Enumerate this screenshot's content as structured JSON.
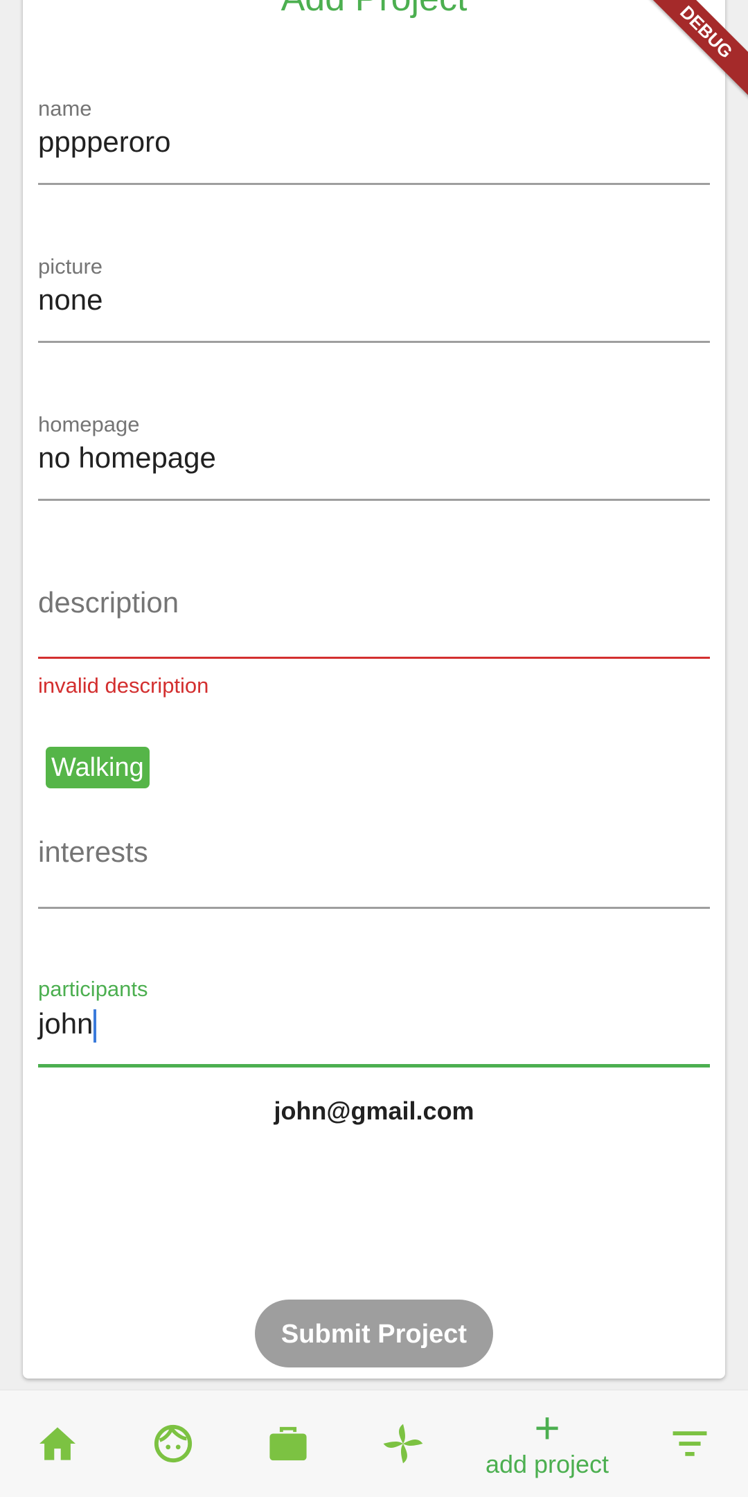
{
  "header": {
    "title": "Add Project"
  },
  "form": {
    "name": {
      "label": "name",
      "value": "pppperoro"
    },
    "picture": {
      "label": "picture",
      "value": "none"
    },
    "homepage": {
      "label": "homepage",
      "value": "no homepage"
    },
    "description": {
      "placeholder": "description",
      "error": "invalid description"
    },
    "interests": {
      "chips": [
        "Walking"
      ],
      "placeholder": "interests"
    },
    "participants": {
      "label": "participants",
      "value": "john",
      "suggestion": "john@gmail.com"
    },
    "submit_label": "Submit Project"
  },
  "bottom_nav": {
    "items": [
      {
        "icon": "home-icon"
      },
      {
        "icon": "face-icon"
      },
      {
        "icon": "briefcase-icon"
      },
      {
        "icon": "pinwheel-icon"
      },
      {
        "icon": "plus-icon",
        "label": "add project"
      },
      {
        "icon": "filter-icon"
      }
    ]
  },
  "debug_banner": "DEBUG",
  "colors": {
    "accent": "#4caf50",
    "error": "#d32f2f",
    "icon": "#7cc242",
    "chip": "#55b548",
    "button_disabled": "#9e9e9e"
  }
}
